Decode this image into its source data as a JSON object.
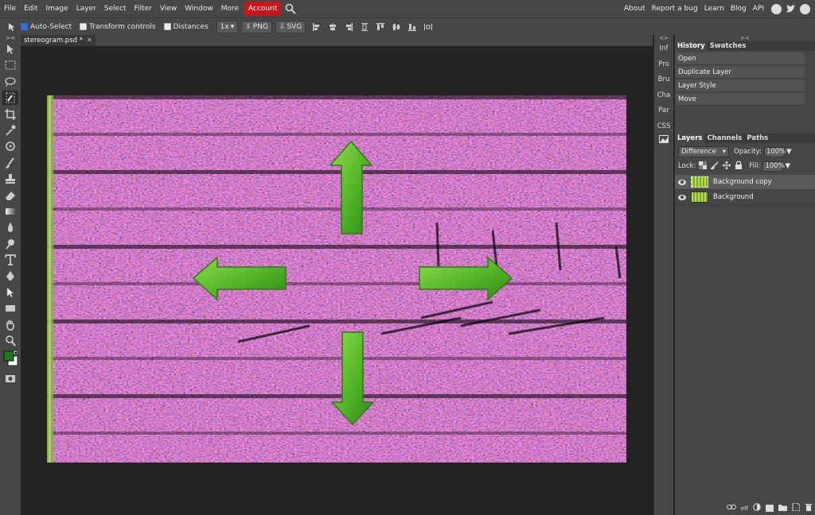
{
  "menubar": {
    "items": [
      "File",
      "Edit",
      "Image",
      "Layer",
      "Select",
      "Filter",
      "View",
      "Window",
      "More"
    ],
    "account": "Account",
    "right_links": [
      "About",
      "Report a bug",
      "Learn",
      "Blog",
      "API"
    ],
    "social_icons": [
      "reddit-icon",
      "twitter-icon",
      "facebook-icon"
    ]
  },
  "options": {
    "auto_select_label": "Auto-Select",
    "auto_select_checked": true,
    "transform_controls_label": "Transform controls",
    "transform_controls_checked": false,
    "distances_label": "Distances",
    "distances_checked": false,
    "zoom_value": "1x",
    "png_label": "PNG",
    "svg_label": "SVG"
  },
  "tabs": [
    {
      "label": "stereogram.psd *"
    }
  ],
  "icon_strip": [
    "Inf",
    "Pro",
    "Bru",
    "Cha",
    "Par",
    "CSS"
  ],
  "history": {
    "tabs": [
      "History",
      "Swatches"
    ],
    "items": [
      "Open",
      "Duplicate Layer",
      "Layer Style",
      "Move"
    ]
  },
  "layers": {
    "tabs": [
      "Layers",
      "Channels",
      "Paths"
    ],
    "blend_mode": "Difference",
    "opacity_label": "Opacity:",
    "opacity_value": "100%",
    "lock_label": "Lock:",
    "fill_label": "Fill:",
    "fill_value": "100%",
    "items": [
      {
        "name": "Background copy",
        "selected": true
      },
      {
        "name": "Background",
        "selected": false
      }
    ],
    "footer_fx": "eff"
  },
  "colors": {
    "ui_bg": "#474747",
    "canvas_bg": "#232323",
    "account_red": "#c7161c",
    "foreground_color": "#1f7a1f",
    "arrow_green": "#57b82a"
  }
}
